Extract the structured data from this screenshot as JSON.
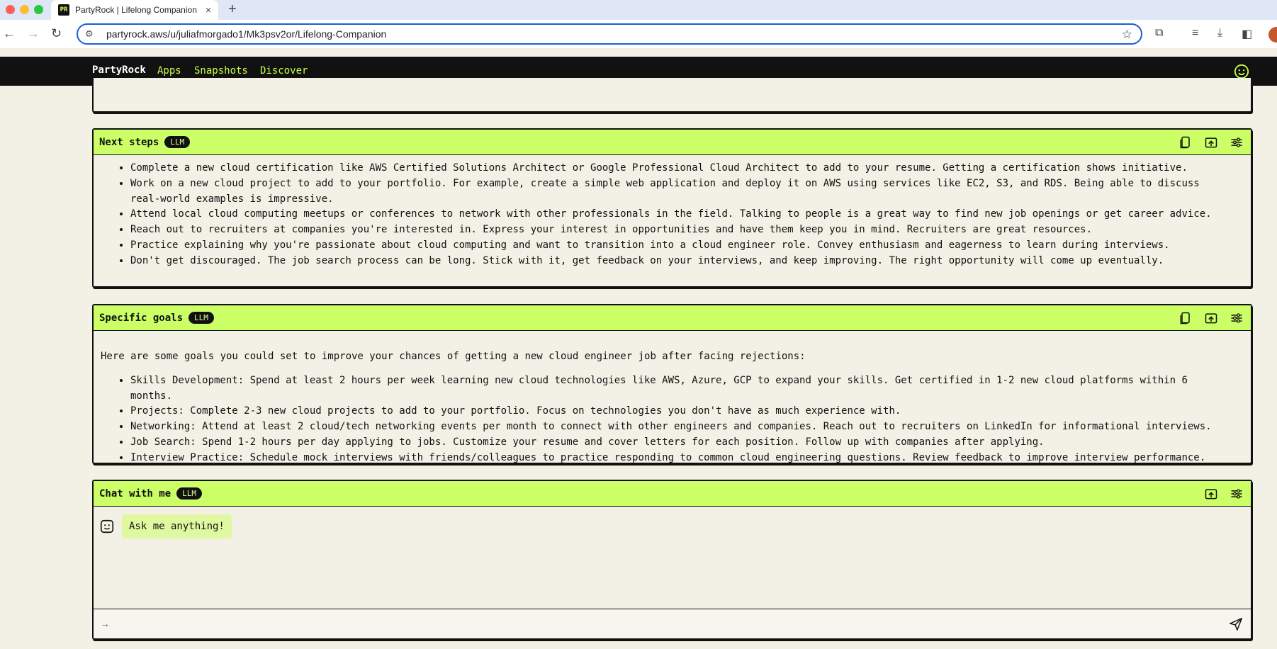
{
  "browser": {
    "tab_title": "PartyRock | Lifelong Companion",
    "favicon_text": "PR",
    "tab_close": "×",
    "new_tab": "+",
    "url": "partyrock.aws/u/juliafmorgado1/Mk3psv2or/Lifelong-Companion"
  },
  "app": {
    "brand": "PartyRock",
    "nav": [
      "Apps",
      "Snapshots",
      "Discover"
    ],
    "accent": "#ccff66"
  },
  "widgets": {
    "next_steps": {
      "title": "Next steps",
      "badge": "LLM",
      "items": [
        "Complete a new cloud certification like AWS Certified Solutions Architect or Google Professional Cloud Architect to add to your resume. Getting a certification shows initiative.",
        "Work on a new cloud project to add to your portfolio. For example, create a simple web application and deploy it on AWS using services like EC2, S3, and RDS. Being able to discuss real-world examples is impressive.",
        "Attend local cloud computing meetups or conferences to network with other professionals in the field. Talking to people is a great way to find new job openings or get career advice.",
        "Reach out to recruiters at companies you're interested in. Express your interest in opportunities and have them keep you in mind. Recruiters are great resources.",
        "Practice explaining why you're passionate about cloud computing and want to transition into a cloud engineer role. Convey enthusiasm and eagerness to learn during interviews.",
        "Don't get discouraged. The job search process can be long. Stick with it, get feedback on your interviews, and keep improving. The right opportunity will come up eventually."
      ]
    },
    "specific_goals": {
      "title": "Specific goals",
      "badge": "LLM",
      "intro": "Here are some goals you could set to improve your chances of getting a new cloud engineer job after facing rejections:",
      "items": [
        "Skills Development: Spend at least 2 hours per week learning new cloud technologies like AWS, Azure, GCP to expand your skills. Get certified in 1-2 new cloud platforms within 6 months.",
        "Projects: Complete 2-3 new cloud projects to add to your portfolio. Focus on technologies you don't have as much experience with.",
        "Networking: Attend at least 2 cloud/tech networking events per month to connect with other engineers and companies. Reach out to recruiters on LinkedIn for informational interviews.",
        "Job Search: Spend 1-2 hours per day applying to jobs. Customize your resume and cover letters for each position. Follow up with companies after applying.",
        "Interview Practice: Schedule mock interviews with friends/colleagues to practice responding to common cloud engineering questions. Review feedback to improve interview performance."
      ]
    },
    "chat": {
      "title": "Chat with me",
      "badge": "LLM",
      "message": "Ask me anything!",
      "input_placeholder": "",
      "input_prefix": "→"
    }
  }
}
